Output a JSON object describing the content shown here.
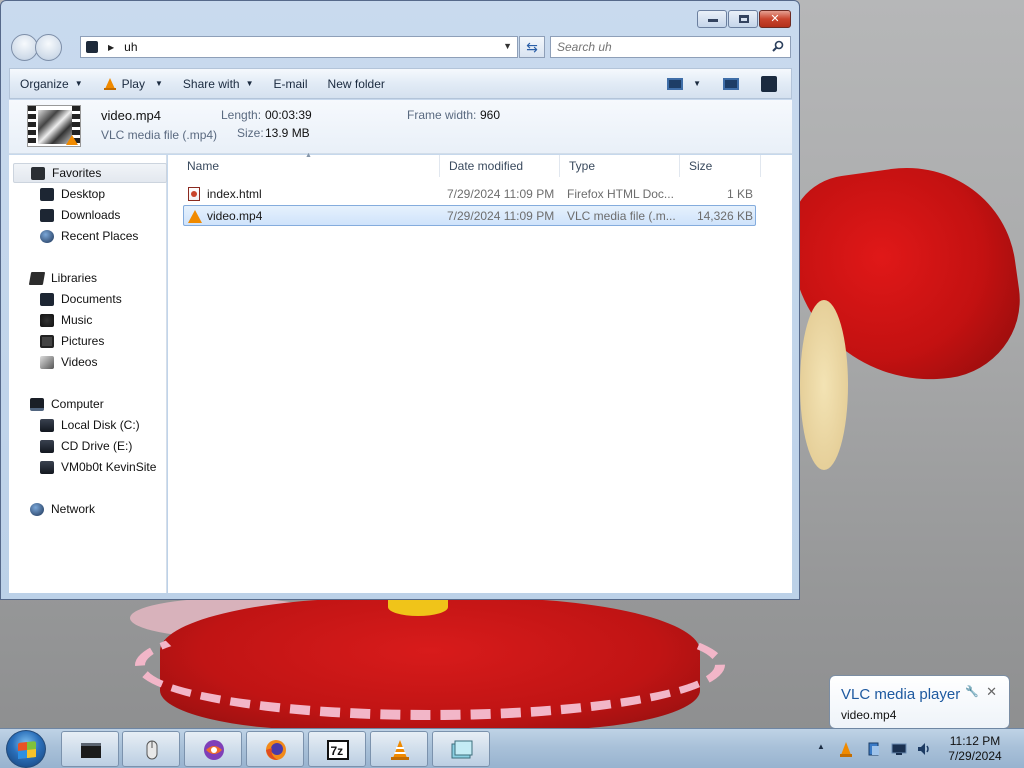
{
  "window": {
    "address": {
      "path": "uh"
    },
    "search": {
      "placeholder": "Search uh"
    },
    "commands": {
      "organize": "Organize",
      "play": "Play",
      "share": "Share with",
      "email": "E-mail",
      "new_folder": "New folder"
    },
    "details": {
      "file_name": "video.mp4",
      "file_type": "VLC media file (.mp4)",
      "length_label": "Length:",
      "length_value": "00:03:39",
      "size_label": "Size:",
      "size_value": "13.9 MB",
      "frame_label": "Frame width:",
      "frame_value": "960"
    },
    "nav": {
      "favorites": "Favorites",
      "desktop": "Desktop",
      "downloads": "Downloads",
      "recent": "Recent Places",
      "libraries": "Libraries",
      "documents": "Documents",
      "music": "Music",
      "pictures": "Pictures",
      "videos": "Videos",
      "computer": "Computer",
      "local_disk": "Local Disk (C:)",
      "cd_drive": "CD Drive (E:)",
      "network_drive": "VM0b0t KevinSite",
      "network": "Network"
    },
    "columns": {
      "name": "Name",
      "date": "Date modified",
      "type": "Type",
      "size": "Size"
    },
    "files": [
      {
        "name": "index.html",
        "date": "7/29/2024 11:09 PM",
        "type": "Firefox HTML Doc...",
        "size": "1 KB"
      },
      {
        "name": "video.mp4",
        "date": "7/29/2024 11:09 PM",
        "type": "VLC media file (.m...",
        "size": "14,326 KB"
      }
    ]
  },
  "balloon": {
    "title": "VLC media player",
    "text": "video.mp4"
  },
  "clock": {
    "time": "11:12 PM",
    "date": "7/29/2024"
  },
  "colors": {
    "accent": "#1e5aa0",
    "selection": "#cfe3fb",
    "vlc_orange": "#f08a00"
  }
}
